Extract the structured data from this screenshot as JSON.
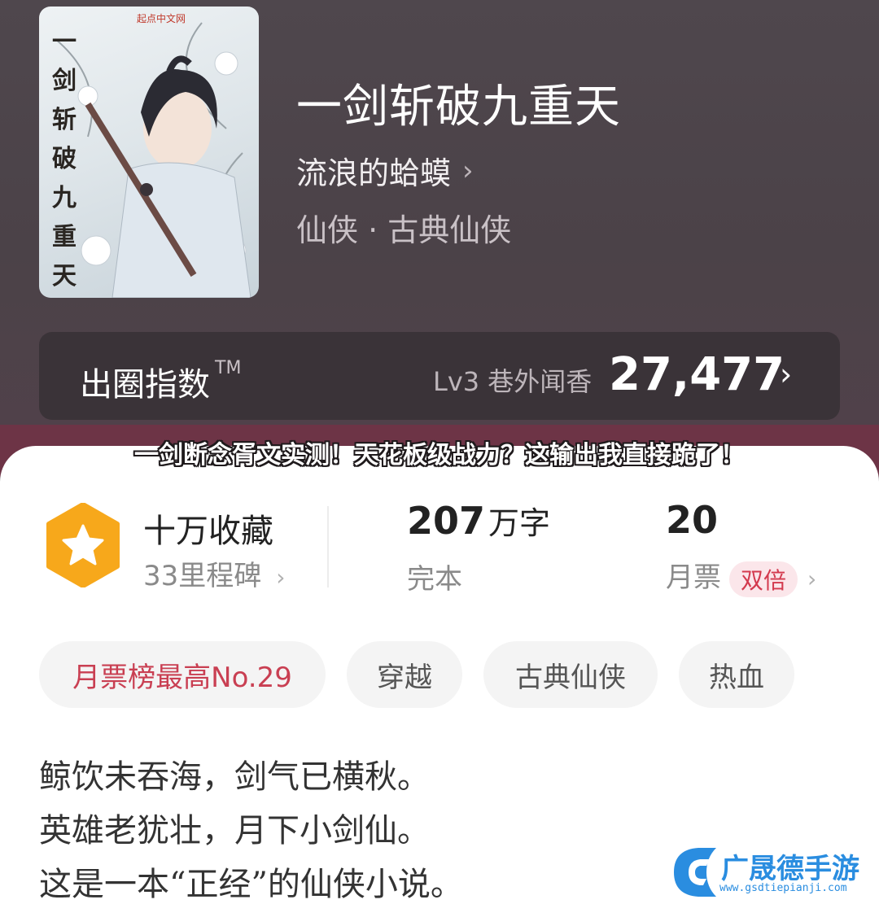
{
  "book": {
    "cover_title": "一剑斩破九重天",
    "cover_publisher": "起点中文网",
    "title": "一剑斩破九重天",
    "author": "流浪的蛤蟆",
    "author_chevron": "›",
    "genre": "仙侠 · 古典仙侠"
  },
  "index": {
    "label": "出圈指数",
    "tm": "TM",
    "level": "Lv3 巷外闻香",
    "score": "27,477",
    "chevron": "›"
  },
  "banner": {
    "text": "一剑断念胥文实测！天花板级战力？这输出我直接跪了！"
  },
  "stats": {
    "collect_main": "十万收藏",
    "collect_sub": "33里程碑",
    "words_num": "207",
    "words_unit": "万字",
    "words_sub": "完本",
    "tickets_num": "20",
    "tickets_sub": "月票",
    "tickets_badge": "双倍",
    "chevron": "›"
  },
  "tags": [
    "月票榜最高No.29",
    "穿越",
    "古典仙侠",
    "热血"
  ],
  "description": [
    "鲸饮未吞海，剑气已横秋。",
    "英雄老犹壮，月下小剑仙。",
    "这是一本“正经”的仙侠小说。"
  ],
  "watermark": {
    "name": "广晟德手游",
    "url": "www.gsdtiepianji.com"
  },
  "colors": {
    "header_bg": "#4b4248",
    "banner_bg": "#6d3446",
    "accent_red": "#c93f52",
    "badge_orange": "#f7a81b",
    "watermark_blue": "#2a8de0"
  }
}
